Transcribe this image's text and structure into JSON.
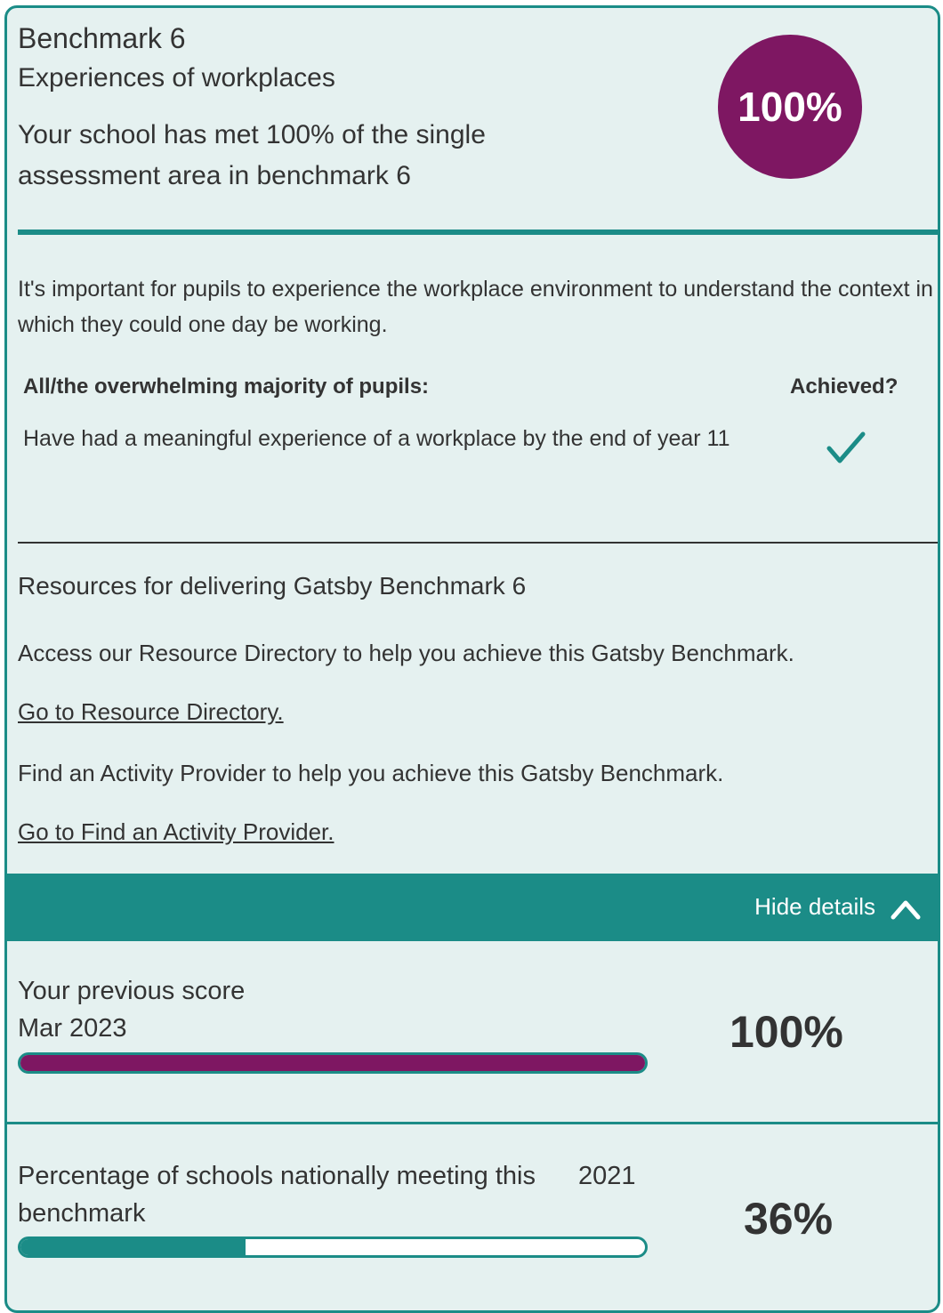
{
  "benchmark": {
    "title": "Benchmark 6",
    "subtitle": "Experiences of workplaces",
    "summary": "Your school has met 100% of the single assessment area in benchmark 6",
    "score": "100%"
  },
  "intro": "It's important for pupils to experience the workplace environment to understand the context in which they could one day be working.",
  "criteria": {
    "header_left": "All/the overwhelming majority of pupils:",
    "header_right": "Achieved?",
    "items": [
      {
        "text": "Have had a meaningful experience of a workplace by the end of year 11",
        "achieved": true,
        "icon": "checkmark-icon"
      }
    ]
  },
  "resources": {
    "title": "Resources for delivering Gatsby Benchmark 6",
    "directory_text": "Access our Resource Directory to help you achieve this Gatsby Benchmark.",
    "directory_link": "Go to Resource Directory.",
    "provider_text": "Find an Activity Provider to help you achieve this Gatsby Benchmark.",
    "provider_link": "Go to Find an Activity Provider."
  },
  "details_toggle": {
    "label": "Hide details",
    "icon": "chevron-up-icon"
  },
  "previous": {
    "label": "Your previous score",
    "date": "Mar 2023",
    "value": "100%",
    "fraction": 1.0
  },
  "national": {
    "label": "Percentage of schools nationally meeting this benchmark",
    "year": "2021",
    "value": "36%",
    "fraction": 0.36
  },
  "colors": {
    "teal": "#1b8c87",
    "plum": "#7e1762",
    "card_bg": "#e5f1f0"
  }
}
